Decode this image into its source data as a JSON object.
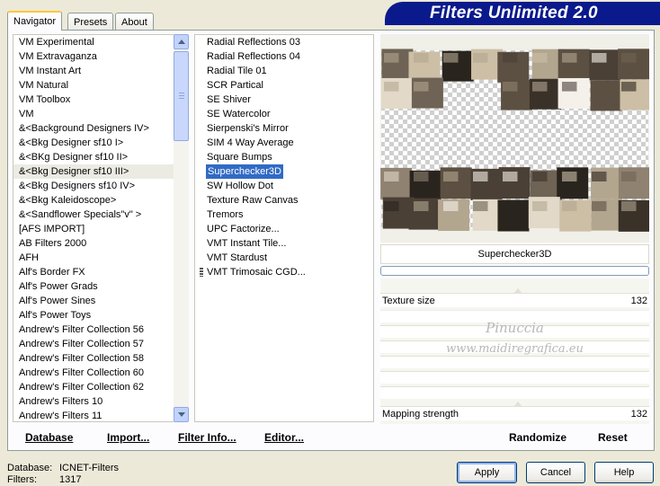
{
  "tabs": [
    "Navigator",
    "Presets",
    "About"
  ],
  "app_title": "Filters Unlimited 2.0",
  "categories": [
    "VM Experimental",
    "VM Extravaganza",
    "VM Instant Art",
    "VM Natural",
    "VM Toolbox",
    "VM",
    "&<Background Designers IV>",
    "&<Bkg Designer sf10 I>",
    "&<BKg Designer sf10 II>",
    "&<Bkg Designer sf10 III>",
    "&<Bkg Designers sf10 IV>",
    "&<Bkg Kaleidoscope>",
    "&<Sandflower Specials\"v\" >",
    "[AFS IMPORT]",
    "AB Filters 2000",
    "AFH",
    "Alf's Border FX",
    "Alf's Power Grads",
    "Alf's Power Sines",
    "Alf's Power Toys",
    "Andrew's Filter Collection 56",
    "Andrew's Filter Collection 57",
    "Andrew's Filter Collection 58",
    "Andrew's Filter Collection 60",
    "Andrew's Filter Collection 62",
    "Andrew's Filters 10",
    "Andrew's Filters 11"
  ],
  "selected_category_index": 9,
  "filters": [
    "Radial Reflections 03",
    "Radial Reflections 04",
    "Radial Tile 01",
    "SCR  Partical",
    "SE Shiver",
    "SE Watercolor",
    "Sierpenski's Mirror",
    "SIM 4 Way Average",
    "Square Bumps",
    "Superchecker3D",
    "SW Hollow Dot",
    "Texture Raw Canvas",
    "Tremors",
    "UPC Factorize...",
    "VMT Instant Tile...",
    "VMT Stardust",
    "VMT Trimosaic CGD..."
  ],
  "selected_filter_index": 9,
  "preview_name": "Superchecker3D",
  "progress": 0,
  "params": [
    {
      "label": "Texture size",
      "value": "132"
    },
    {
      "label": "Mapping strength",
      "value": "132"
    }
  ],
  "watermark": [
    "Pinuccia",
    "www.maidiregrafica.eu"
  ],
  "bottom_links": [
    "Database",
    "Import...",
    "Filter Info...",
    "Editor...",
    "Randomize",
    "Reset"
  ],
  "status": {
    "database_label": "Database:",
    "database_value": "ICNET-Filters",
    "filters_label": "Filters:",
    "filters_value": "1317"
  },
  "buttons": {
    "apply": "Apply",
    "cancel": "Cancel",
    "help": "Help"
  },
  "colors": {
    "selection": "#316ac5",
    "title_bg": "#0a1a8c",
    "window_bg": "#ece9d8"
  }
}
